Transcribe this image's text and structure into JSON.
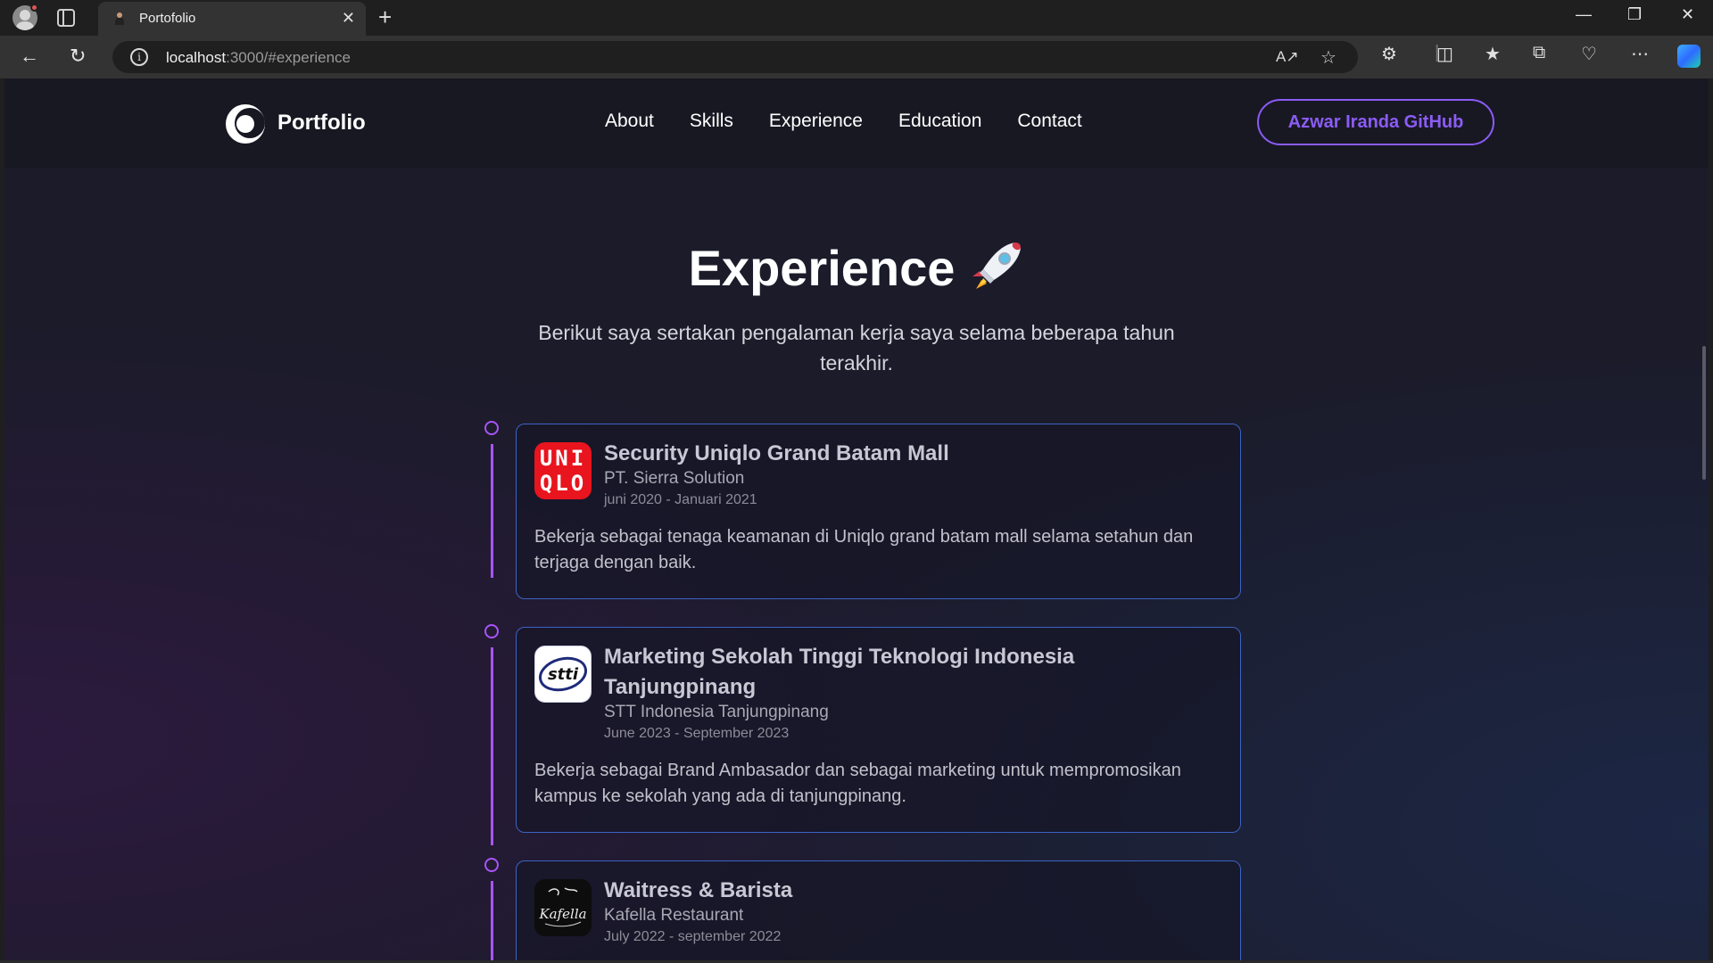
{
  "browser": {
    "tab_title": "Portofolio",
    "tab_close": "✕",
    "new_tab": "+",
    "url_host": "localhost",
    "url_path": ":3000/#experience",
    "window_minimize": "—",
    "window_restore": "❐",
    "window_close": "✕"
  },
  "header": {
    "brand": "Portfolio",
    "nav": [
      "About",
      "Skills",
      "Experience",
      "Education",
      "Contact"
    ],
    "cta": "Azwar Iranda GitHub"
  },
  "experience": {
    "title": "Experience",
    "description": "Berikut saya sertakan pengalaman kerja saya selama beberapa tahun terakhir.",
    "items": [
      {
        "role": "Security Uniqlo Grand Batam Mall",
        "company": "PT. Sierra Solution",
        "date": "juni 2020 - Januari 2021",
        "description": "Bekerja sebagai tenaga keamanan di Uniqlo grand batam mall selama setahun dan terjaga dengan baik.",
        "logo_text": [
          "UNI",
          "QLO"
        ]
      },
      {
        "role": "Marketing Sekolah Tinggi Teknologi Indonesia Tanjungpinang",
        "company": "STT Indonesia Tanjungpinang",
        "date": "June 2023 - September 2023",
        "description": "Bekerja sebagai Brand Ambasador dan sebagai marketing untuk mempromosikan kampus ke sekolah yang ada di tanjungpinang.",
        "logo_text": "stti"
      },
      {
        "role": "Waitress & Barista",
        "company": "Kafella Restaurant",
        "date": "July 2022 - september 2022",
        "description": "",
        "logo_text": "Kafella"
      }
    ]
  },
  "colors": {
    "accent": "#a855f7",
    "cta": "#8b5cf6",
    "card_border": "#3b63c4",
    "header_bg": "#181823",
    "page_bg": "#1b1b2a",
    "uniqlo_red": "#e8141e"
  },
  "icons": [
    "profile-avatar",
    "tab-actions",
    "back-arrow",
    "refresh",
    "site-info",
    "read-aloud",
    "favorite-star",
    "extensions",
    "split-screen",
    "favorites",
    "collections",
    "browser-essentials",
    "more",
    "copilot",
    "rocket-emoji"
  ]
}
